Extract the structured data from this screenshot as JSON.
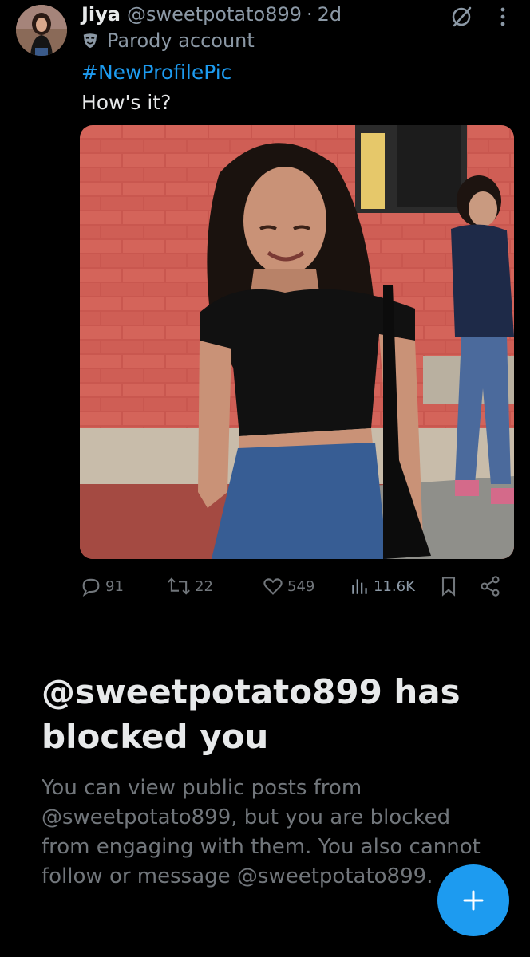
{
  "post": {
    "author": {
      "display_name": "Jiya",
      "handle": "@sweetpotato899",
      "age": "2d",
      "label": "Parody account",
      "label_icon": "mask-icon"
    },
    "hashtag": "#NewProfilePic",
    "text": "How's it?",
    "media_icon": "photo",
    "stats": {
      "replies": "91",
      "reposts": "22",
      "likes": "549",
      "views": "11.6K"
    },
    "icons": [
      "grok-icon",
      "more-icon",
      "reply-icon",
      "repost-icon",
      "like-icon",
      "views-icon",
      "bookmark-icon",
      "share-icon"
    ]
  },
  "block_notice": {
    "title": "@sweetpotato899 has blocked you",
    "description": "You can view public posts from @sweetpotato899, but you are blocked from engaging with them. You also cannot follow or message @sweetpotato899."
  },
  "fab": {
    "icon": "plus-icon"
  },
  "colors": {
    "background": "#000000",
    "text_primary": "#e7e9ea",
    "text_secondary": "#71767b",
    "accent": "#1d9bf0",
    "divider": "#2f3336"
  }
}
